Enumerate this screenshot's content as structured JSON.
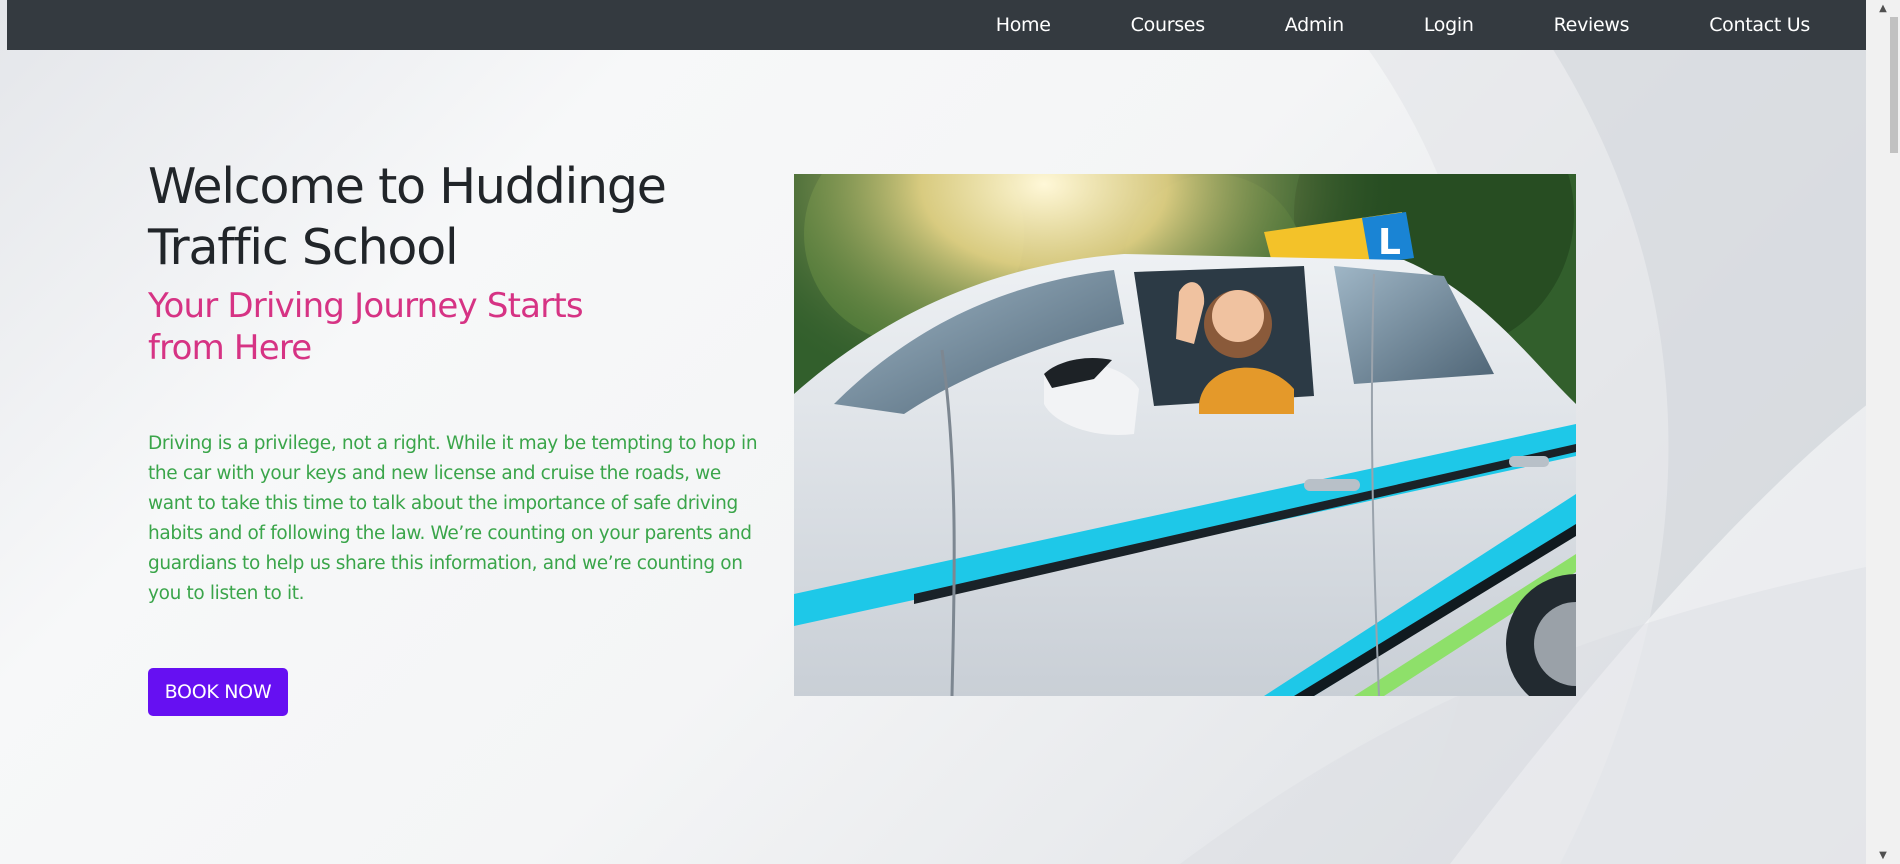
{
  "nav": {
    "items": [
      {
        "label": "Home"
      },
      {
        "label": "Courses"
      },
      {
        "label": "Admin"
      },
      {
        "label": "Login"
      },
      {
        "label": "Reviews"
      },
      {
        "label": "Contact Us"
      }
    ]
  },
  "hero": {
    "title": "Welcome to Huddinge Traffic School",
    "subtitle": "Your Driving Journey Starts from Here",
    "text": "Driving is a privilege, not a right. While it may be tempting to hop in the car with your keys and new license and cruise the roads, we want to take this time to talk about the importance of safe driving habits and of following the law. We’re counting on your parents and guardians to help us share this information, and we’re counting on you to listen to it.",
    "button_label": "BOOK NOW",
    "learner_sign": "L"
  },
  "colors": {
    "navbar": "#343a40",
    "title": "#212529",
    "subtitle": "#d63384",
    "text": "#3aa54a",
    "button": "#6610f2"
  },
  "icons": {
    "scroll_up": "chevron-up-icon",
    "scroll_down": "chevron-down-icon"
  }
}
